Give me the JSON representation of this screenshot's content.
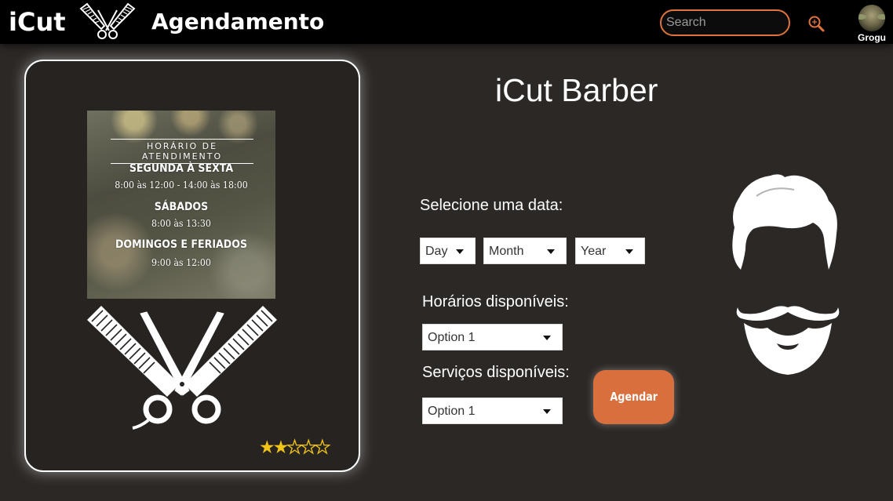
{
  "header": {
    "brand": "iCut",
    "brand_icon": "scissors-comb-icon",
    "page_title": "Agendamento",
    "search_placeholder": "Search",
    "search_icon": "search-icon",
    "user_name": "Grogu"
  },
  "card": {
    "hours_sign": {
      "title": "HORÁRIO DE ATENDIMENTO",
      "weekdays_label": "SEGUNDA À SEXTA",
      "weekdays_hours": "8:00 às 12:00 - 14:00 às 18:00",
      "saturday_label": "SÁBADOS",
      "saturday_hours": "8:00 às 13:30",
      "sunday_label": "DOMINGOS E FERIADOS",
      "sunday_hours": "9:00 às 12:00"
    },
    "rating": {
      "stars": 2,
      "max": 5
    }
  },
  "main": {
    "shop_name": "iCut Barber",
    "date_label": "Selecione uma data:",
    "day_select": "Day",
    "month_select": "Month",
    "year_select": "Year",
    "times_label": "Horários disponíveis:",
    "times_select": "Option 1",
    "services_label": "Serviços disponíveis:",
    "services_select": "Option 1",
    "schedule_button": "Agendar"
  },
  "colors": {
    "background": "#2c2826",
    "topbar": "#000000",
    "accent": "#d96f3d",
    "star": "#f0c419"
  }
}
